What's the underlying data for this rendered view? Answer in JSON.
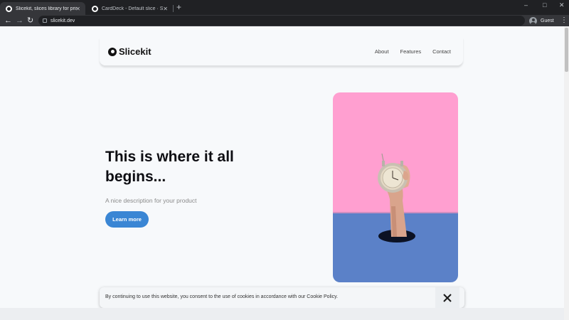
{
  "browser": {
    "tabs": [
      {
        "title": "Slicekit, slices library for prismic",
        "active": true
      },
      {
        "title": "CardDeck - Default slice · Storyb",
        "active": false
      }
    ],
    "url": "slicekit.dev",
    "profile_label": "Guest"
  },
  "site": {
    "logo_text": "Slicekit",
    "nav": [
      "About",
      "Features",
      "Contact"
    ],
    "hero": {
      "title": "This is where it all begins...",
      "description": "A nice description for your product",
      "cta_label": "Learn more"
    },
    "cookie": {
      "text": "By continuing to use this website, you consent to the use of cookies in accordance with our Cookie Policy."
    }
  },
  "colors": {
    "accent": "#3a86d4",
    "image_top": "#ff9fd0",
    "image_bottom": "#5b81c8"
  },
  "icons": {
    "back": "arrow-left-icon",
    "forward": "arrow-right-icon",
    "reload": "reload-icon",
    "close": "close-icon"
  }
}
